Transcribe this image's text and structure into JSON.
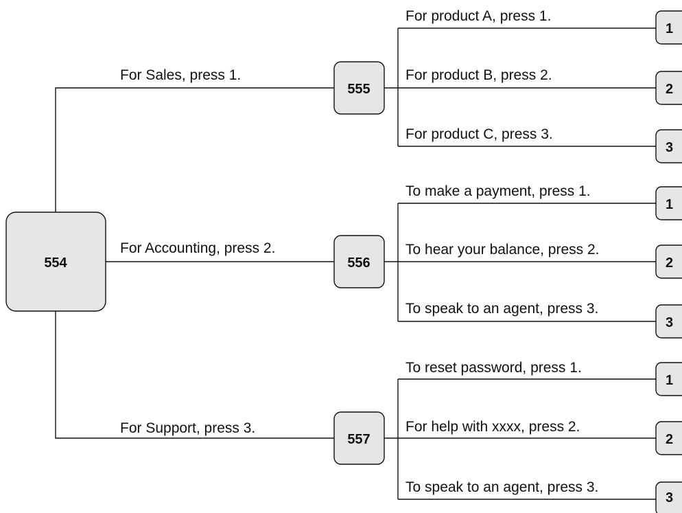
{
  "root": {
    "id": "554",
    "branches": [
      {
        "prompt": "For Sales, press 1.",
        "id": "555",
        "options": [
          {
            "text": "For product A, press 1.",
            "key": "1"
          },
          {
            "text": "For product B, press 2.",
            "key": "2"
          },
          {
            "text": "For product C, press 3.",
            "key": "3"
          }
        ]
      },
      {
        "prompt": "For Accounting, press 2.",
        "id": "556",
        "options": [
          {
            "text": "To make a payment, press  1.",
            "key": "1"
          },
          {
            "text": "To hear your balance, press 2.",
            "key": "2"
          },
          {
            "text": "To speak to an agent, press 3.",
            "key": "3"
          }
        ]
      },
      {
        "prompt": "For Support, press 3.",
        "id": "557",
        "options": [
          {
            "text": "To reset password, press 1.",
            "key": "1"
          },
          {
            "text": "For help with xxxx, press 2.",
            "key": "2"
          },
          {
            "text": "To speak to an agent, press 3.",
            "key": "3"
          }
        ]
      }
    ]
  },
  "colors": {
    "node_fill": "#e6e6e6",
    "line": "#111111"
  }
}
